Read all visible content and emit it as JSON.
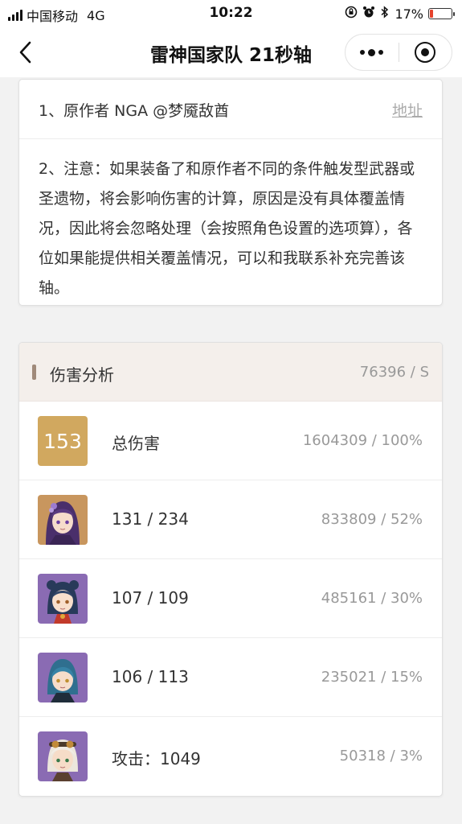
{
  "status_bar": {
    "carrier": "中国移动",
    "network": "4G",
    "time": "10:22",
    "battery": "17%",
    "battery_level": 0.17
  },
  "nav": {
    "title": "雷神国家队 21秒轴"
  },
  "notice": {
    "line1": "1、原作者 NGA @梦魇敌酋",
    "link": "地址",
    "line2": "2、注意：如果装备了和原作者不同的条件触发型武器或圣遗物，将会影响伤害的计算，原因是没有具体覆盖情况，因此将会忽略处理（会按照角色设置的选项算），各位如果能提供相关覆盖情况，可以和我联系补充完善该轴。"
  },
  "damage": {
    "title": "伤害分析",
    "dps": "76396 / S",
    "rows": [
      {
        "badge": "153",
        "label": "总伤害",
        "value": "1604309 / 100%"
      },
      {
        "label": "131 / 234",
        "value": "833809 / 52%",
        "icon": "raiden-shogun-avatar"
      },
      {
        "label": "107 / 109",
        "value": "485161 / 30%",
        "icon": "xiangling-avatar"
      },
      {
        "label": "106 / 113",
        "value": "235021 / 15%",
        "icon": "xingqiu-avatar"
      },
      {
        "label": "攻击：1049",
        "value": "50318 / 3%",
        "icon": "bennett-avatar"
      }
    ]
  },
  "colors": {
    "badge": "#d1a85f",
    "avatar_bg_5star": "#c8965e",
    "avatar_bg_4star": "#8a6bb3",
    "header_bg": "#f4efeb"
  }
}
